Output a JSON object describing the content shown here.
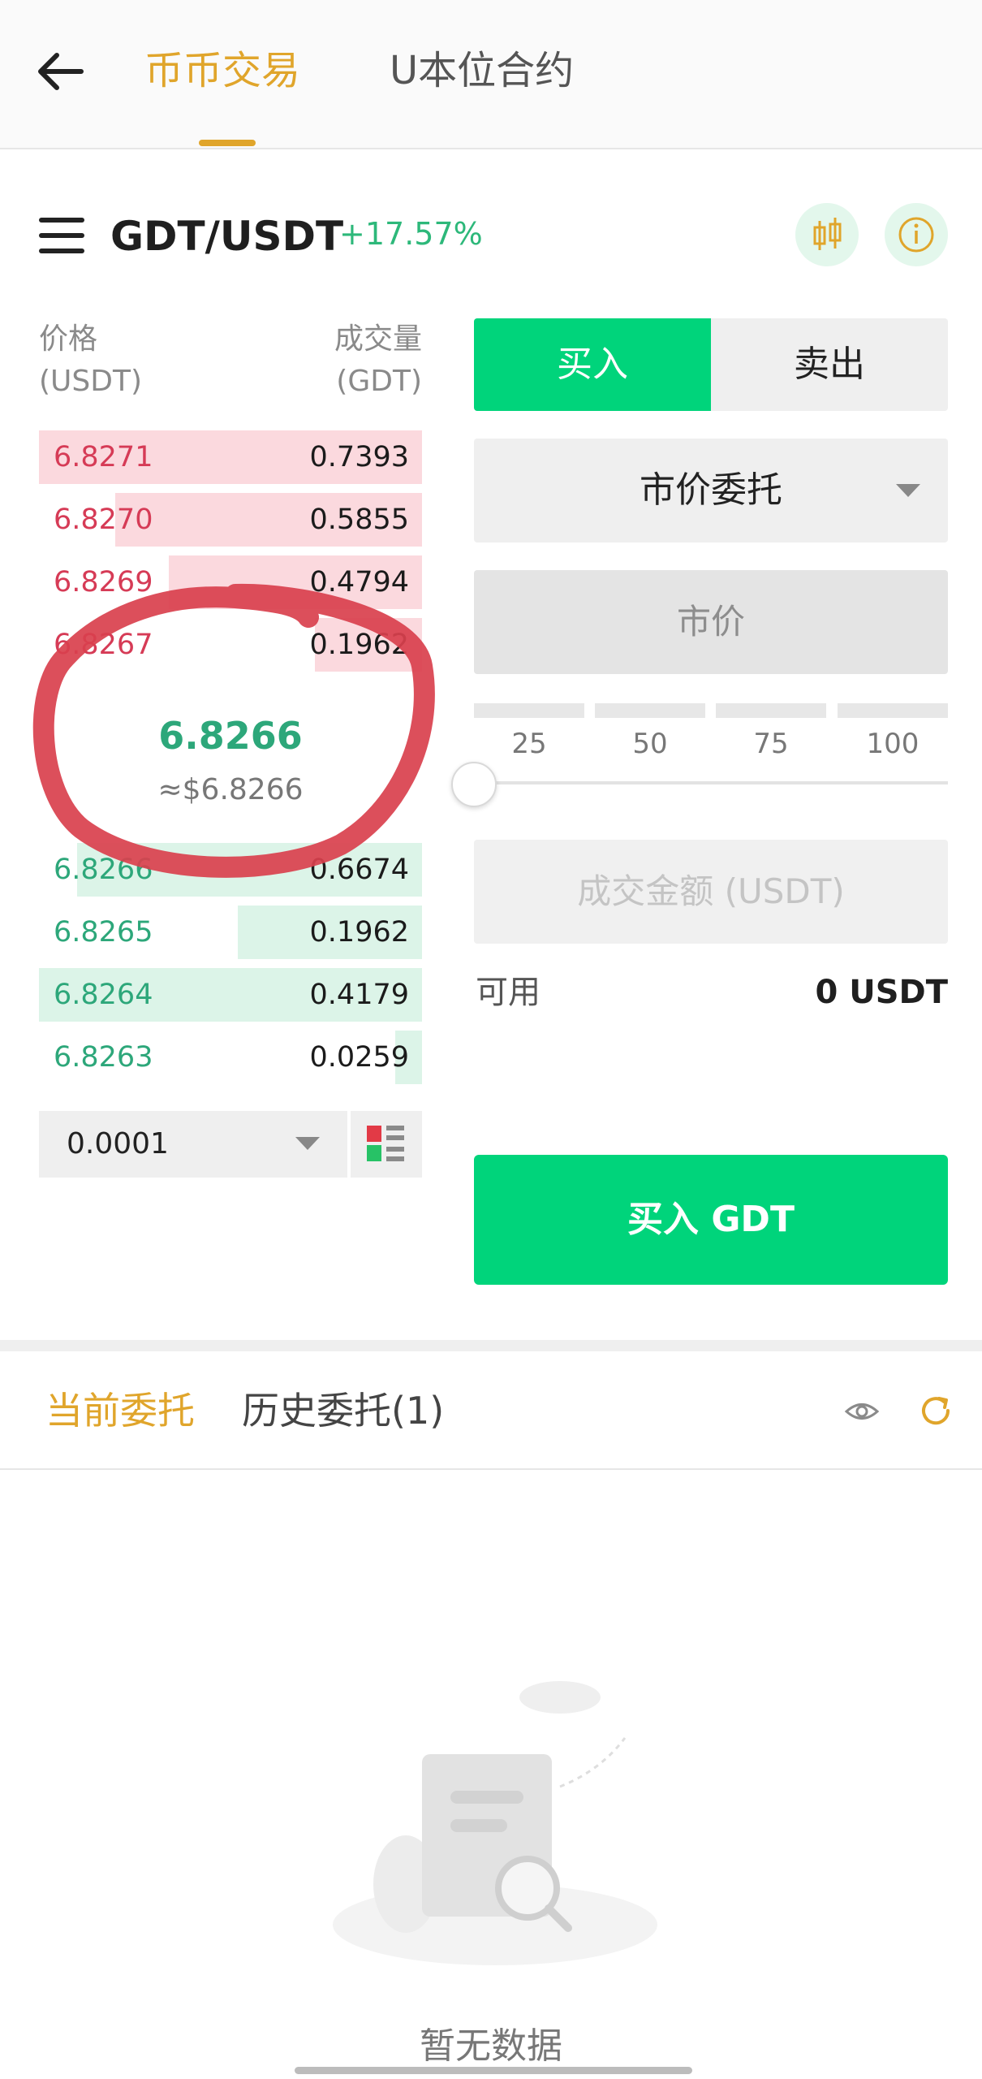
{
  "header": {
    "tabs": [
      {
        "label": "币币交易",
        "active": true
      },
      {
        "label": "U本位合约",
        "active": false
      }
    ],
    "accent_color": "#e0a52b"
  },
  "pair": {
    "symbol": "GDT/USDT",
    "change": "+17.57%",
    "change_color": "#2db87a"
  },
  "orderbook": {
    "price_header": [
      "价格",
      "(USDT)"
    ],
    "amount_header": [
      "成交量",
      "(GDT)"
    ],
    "asks": [
      {
        "price": "6.8271",
        "amount": "0.7393",
        "depth": 1.0
      },
      {
        "price": "6.8270",
        "amount": "0.5855",
        "depth": 0.8
      },
      {
        "price": "6.8269",
        "amount": "0.4794",
        "depth": 0.66
      },
      {
        "price": "6.8267",
        "amount": "0.1962",
        "depth": 0.28
      }
    ],
    "mid_price": "6.8266",
    "mid_price_usd": "≈$6.8266",
    "bids": [
      {
        "price": "6.8266",
        "amount": "0.6674",
        "depth": 0.9
      },
      {
        "price": "6.8265",
        "amount": "0.1962",
        "depth": 0.48
      },
      {
        "price": "6.8264",
        "amount": "0.4179",
        "depth": 1.0
      },
      {
        "price": "6.8263",
        "amount": "0.0259",
        "depth": 0.07
      }
    ],
    "precision": "0.0001"
  },
  "trade_form": {
    "buy_label": "买入",
    "sell_label": "卖出",
    "order_type": "市价委托",
    "price_placeholder": "市价",
    "percentages": [
      "25",
      "50",
      "75",
      "100"
    ],
    "amount_placeholder": "成交金额 (USDT)",
    "available_label": "可用",
    "available_value": "0 USDT",
    "submit_label": "买入 GDT",
    "buy_color": "#00d47b"
  },
  "orders": {
    "tabs": [
      {
        "label": "当前委托",
        "active": true
      },
      {
        "label": "历史委托(1)",
        "active": false
      }
    ],
    "empty_text": "暂无数据"
  },
  "icons": [
    "back-arrow-icon",
    "menu-icon",
    "candlestick-chart-icon",
    "info-icon",
    "eye-icon",
    "refresh-icon",
    "layout-toggle-icon",
    "chevron-down-icon"
  ]
}
